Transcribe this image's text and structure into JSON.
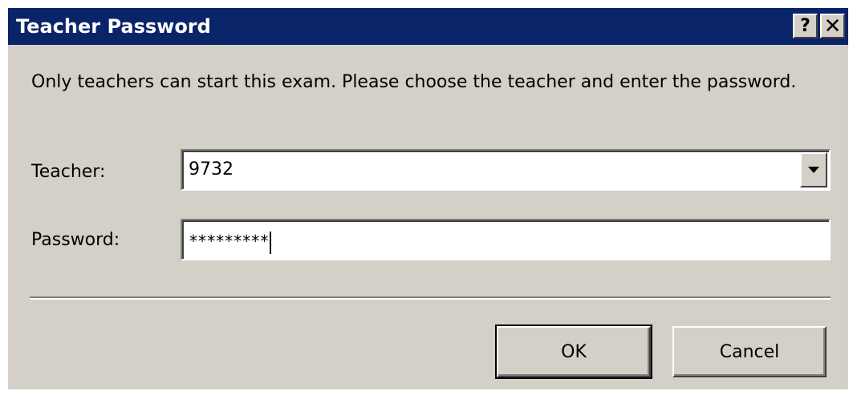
{
  "window": {
    "title": "Teacher Password",
    "help_label": "?",
    "close_label": "✕",
    "colors": {
      "titlebar": "#0a246a",
      "dialog_bg": "#d4d0c8",
      "title_text": "#ffffff"
    }
  },
  "message": "Only teachers can start this exam. Please choose the teacher and enter the password.",
  "teacher": {
    "label": "Teacher:",
    "value": "9732",
    "dropdown_icon": "chevron-down-icon"
  },
  "password": {
    "label": "Password:",
    "masked_value": "*********"
  },
  "buttons": {
    "ok_label": "OK",
    "cancel_label": "Cancel"
  }
}
